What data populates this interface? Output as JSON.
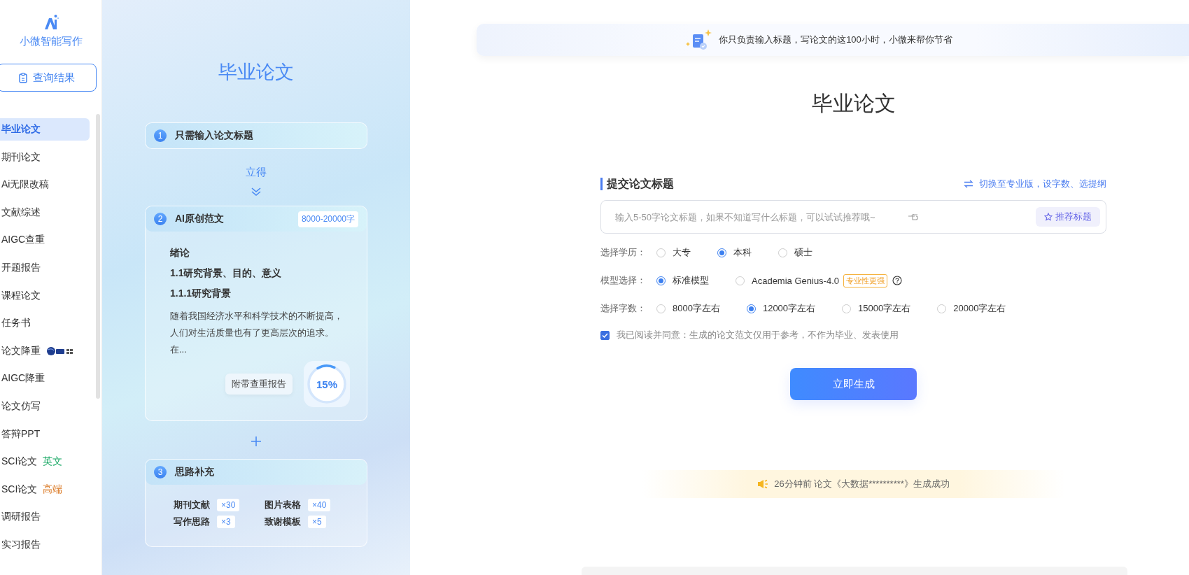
{
  "sidebar": {
    "brand": "小微智能写作",
    "query_button": "查询结果",
    "items": [
      {
        "label": "毕业论文",
        "selected": true
      },
      {
        "label": "期刊论文",
        "selected": false
      },
      {
        "label": "Ai无限改稿",
        "selected": false
      },
      {
        "label": "文献综述",
        "selected": false
      },
      {
        "label": "AIGC查重",
        "selected": false
      },
      {
        "label": "开题报告",
        "selected": false
      },
      {
        "label": "课程论文",
        "selected": false
      },
      {
        "label": "任务书",
        "selected": false
      },
      {
        "label": "论文降重",
        "selected": false,
        "kind": "logo"
      },
      {
        "label": "AIGC降重",
        "selected": false
      },
      {
        "label": "论文仿写",
        "selected": false
      },
      {
        "label": "答辩PPT",
        "selected": false
      },
      {
        "label": "SCI论文",
        "selected": false,
        "kind": "tag",
        "tag": "英文",
        "color": "#18a864"
      },
      {
        "label": "SCI论文",
        "selected": false,
        "kind": "tag",
        "tag": "高端",
        "color": "#d9731a"
      },
      {
        "label": "调研报告",
        "selected": false
      },
      {
        "label": "实习报告",
        "selected": false
      }
    ]
  },
  "showcase": {
    "title": "毕业论文",
    "step1": {
      "number": "1",
      "title": "只需输入论文标题"
    },
    "arrow_label": "立得",
    "step2": {
      "number": "2",
      "title": "AI原创范文",
      "badge": "8000-20000字",
      "headings": [
        "绪论",
        "1.1研究背景、目的、意义",
        "1.1.1研究背景"
      ],
      "paragraph_lines": [
        "随着我国经济水平和科学技术的不断提高，",
        "人们对生活质量也有了更高层次的追求。",
        "在..."
      ],
      "report_label": "附带查重报告",
      "similarity": "15%",
      "level": 0.15
    },
    "step3": {
      "number": "3",
      "title": "思路补充",
      "items": [
        {
          "label": "期刊文献",
          "count": "×30"
        },
        {
          "label": "图片表格",
          "count": "×40"
        },
        {
          "label": "写作思路",
          "count": "×3"
        },
        {
          "label": "致谢模板",
          "count": "×5"
        }
      ]
    }
  },
  "banner": "你只负责输入标题，写论文的这100小时，小微来帮你节省",
  "title": "毕业论文",
  "form": {
    "section_title": "提交论文标题",
    "switch_link": "切换至专业版，设字数、选提纲",
    "placeholder": "输入5-50字论文标题，如果不知道写什么标题，可以试试推荐哦~",
    "recommend_button": "推荐标题",
    "groups": [
      {
        "label": "选择学历：",
        "options": [
          {
            "label": "大专",
            "selected": false
          },
          {
            "label": "本科",
            "selected": true
          },
          {
            "label": "硕士",
            "selected": false
          }
        ]
      },
      {
        "label": "模型选择：",
        "options": [
          {
            "label": "标准模型",
            "selected": true
          },
          {
            "label": "Academia Genius-4.0",
            "selected": false,
            "tag": "专业性更强",
            "help": true
          }
        ]
      },
      {
        "label": "选择字数：",
        "options": [
          {
            "label": "8000字左右",
            "selected": false
          },
          {
            "label": "12000字左右",
            "selected": true
          },
          {
            "label": "15000字左右",
            "selected": false
          },
          {
            "label": "20000字左右",
            "selected": false
          }
        ]
      }
    ],
    "agreement": {
      "checked": true,
      "text": "我已阅读并同意：生成的论文范文仅用于参考，不作为毕业、发表使用"
    },
    "generate_button": "立即生成"
  },
  "notice": "26分钟前 论文《大数据**********》生成成功"
}
